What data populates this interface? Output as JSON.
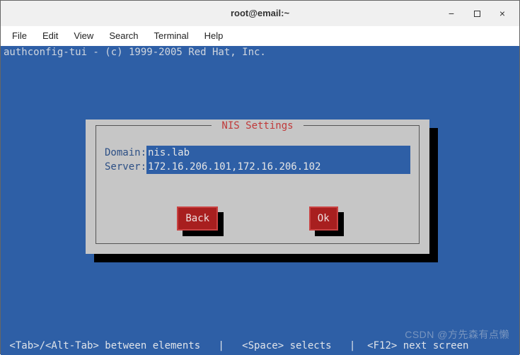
{
  "window": {
    "title": "root@email:~",
    "min_icon": "−",
    "close_icon": "×"
  },
  "menu": {
    "file": "File",
    "edit": "Edit",
    "view": "View",
    "search": "Search",
    "terminal": "Terminal",
    "help": "Help"
  },
  "header_line": "authconfig-tui - (c) 1999-2005 Red Hat, Inc.",
  "dialog": {
    "title": " NIS Settings ",
    "domain_label": "Domain: ",
    "domain_value": "nis.lab",
    "server_label": "Server: ",
    "server_value": "172.16.206.101,172.16.206.102",
    "back_label": " Back ",
    "ok_label": " Ok "
  },
  "footer_line": " <Tab>/<Alt-Tab> between elements   |   <Space> selects   |  <F12> next screen",
  "watermark": "CSDN @方先森有点懒"
}
